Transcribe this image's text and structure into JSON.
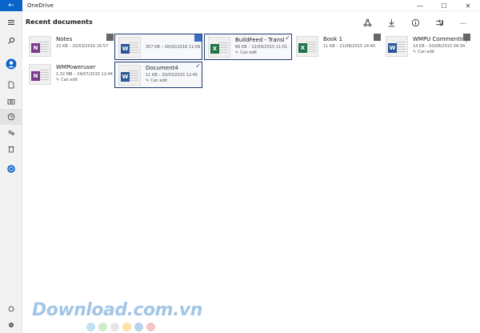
{
  "app": {
    "title": "OneDrive",
    "back_icon": "back-arrow-icon",
    "window_controls": {
      "minimize": "—",
      "maximize": "☐",
      "close": "✕"
    }
  },
  "sidebar": {
    "items": [
      {
        "name": "hamburger-menu-icon",
        "active": false
      },
      {
        "name": "search-icon",
        "active": false
      },
      {
        "name": "account-icon",
        "active": false
      },
      {
        "name": "files-icon",
        "active": false
      },
      {
        "name": "photos-icon",
        "active": false
      },
      {
        "name": "recent-icon",
        "active": true
      },
      {
        "name": "shared-icon",
        "active": false
      },
      {
        "name": "recycle-bin-icon",
        "active": false
      },
      {
        "name": "offline-icon",
        "active": false
      },
      {
        "name": "sync-icon",
        "active": false
      },
      {
        "name": "settings-icon",
        "active": false
      }
    ]
  },
  "main": {
    "title": "Recent documents",
    "toolbar": [
      {
        "name": "share-icon"
      },
      {
        "name": "download-icon"
      },
      {
        "name": "info-icon"
      },
      {
        "name": "open-with-icon"
      },
      {
        "name": "more-icon",
        "label": "..."
      }
    ]
  },
  "documents": [
    {
      "name": "Notes",
      "meta": "22 KB – 20/03/2016 16:57",
      "perm": "",
      "app": "onenote",
      "badge": "N",
      "selected": false
    },
    {
      "name": "",
      "meta": "307 KB – 28/02/2016 11:09",
      "perm": "",
      "app": "word",
      "badge": "W",
      "selected": true
    },
    {
      "name": "BuildFeed - Translation",
      "meta": "66 KB – 12/09/2015 11:01",
      "perm": "Can edit",
      "app": "excel",
      "badge": "X",
      "selected": true
    },
    {
      "name": "Book 1",
      "meta": "11 KB – 21/08/2015 14:40",
      "perm": "",
      "app": "excel",
      "badge": "X",
      "selected": false
    },
    {
      "name": "WMPU Commenting",
      "meta": "14 KB – 03/08/2015 04:34",
      "perm": "Can edit",
      "app": "word",
      "badge": "W",
      "selected": false
    },
    {
      "name": "WMPoweruser",
      "meta": "1.32 MB – 24/07/2015 12:44",
      "perm": "Can edit",
      "app": "onenote",
      "badge": "N",
      "selected": false
    },
    {
      "name": "Document4",
      "meta": "11 KB – 20/03/2015 12:45",
      "perm": "Can edit",
      "app": "word",
      "badge": "W",
      "selected": true
    }
  ],
  "watermark": {
    "text": "Download.com.vn",
    "dot_colors": [
      "#bfe0f2",
      "#cdeacb",
      "#e6e6e6",
      "#fbe3a8",
      "#b9d2ec",
      "#f6c4c4"
    ]
  },
  "colors": {
    "accent": "#0a63c9",
    "selection_border": "#1f3b70",
    "onenote": "#7a3b8d",
    "word": "#2b579a",
    "excel": "#217346"
  }
}
